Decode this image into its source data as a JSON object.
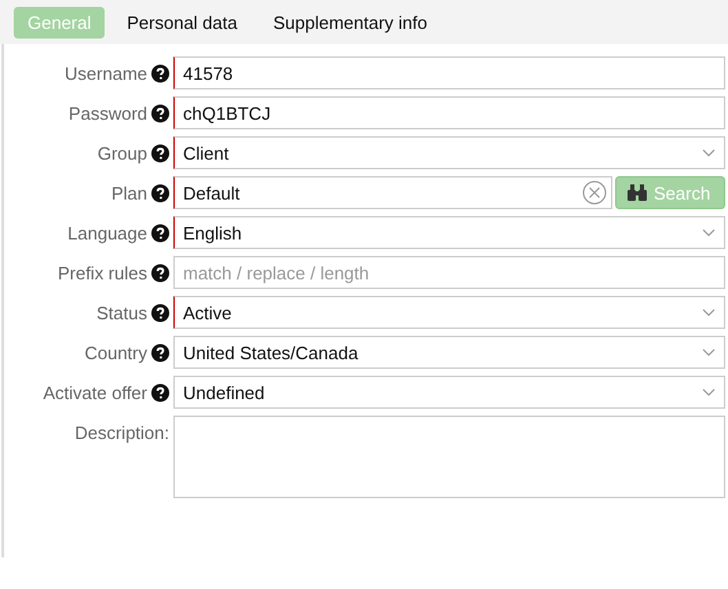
{
  "tabs": [
    {
      "label": "General",
      "selected": true
    },
    {
      "label": "Personal data",
      "selected": false
    },
    {
      "label": "Supplementary info",
      "selected": false
    }
  ],
  "fields": [
    {
      "label": "Username",
      "kind": "text",
      "value": "41578",
      "required": true,
      "help": true
    },
    {
      "label": "Password",
      "kind": "text",
      "value": "chQ1BTCJ",
      "required": true,
      "help": true
    },
    {
      "label": "Group",
      "kind": "select",
      "value": "Client",
      "required": true,
      "help": true
    },
    {
      "label": "Plan",
      "kind": "lookup",
      "value": "Default",
      "required": true,
      "help": true,
      "button": "Search"
    },
    {
      "label": "Language",
      "kind": "select",
      "value": "English",
      "required": true,
      "help": true
    },
    {
      "label": "Prefix rules",
      "kind": "text",
      "placeholder": "match / replace / length",
      "required": false,
      "help": true
    },
    {
      "label": "Status",
      "kind": "select",
      "value": "Active",
      "required": true,
      "help": true
    },
    {
      "label": "Country",
      "kind": "select",
      "value": "United States/Canada",
      "required": false,
      "help": true
    },
    {
      "label": "Activate offer",
      "kind": "select",
      "value": "Undefined",
      "required": false,
      "help": true
    },
    {
      "label": "Description:",
      "kind": "textarea",
      "required": false,
      "help": false
    }
  ]
}
